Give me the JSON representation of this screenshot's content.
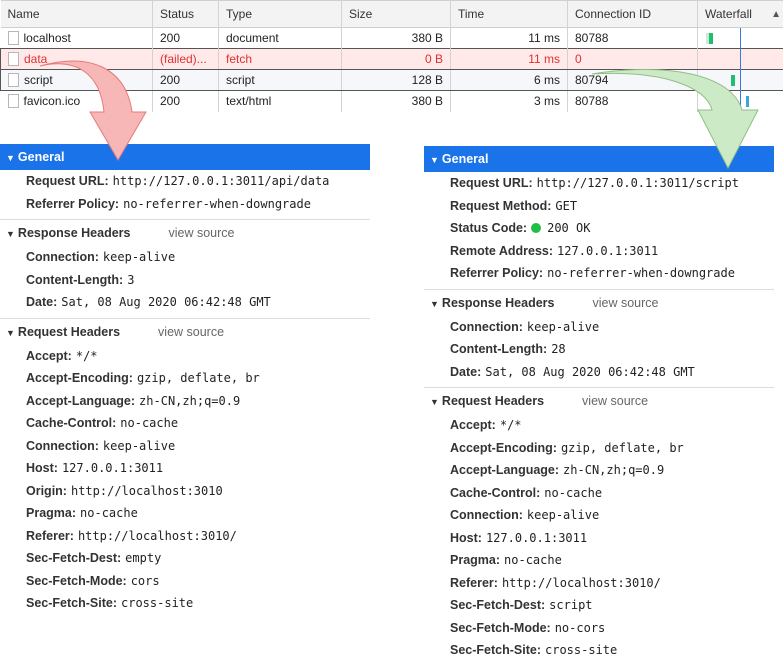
{
  "network": {
    "columns": [
      "Name",
      "Status",
      "Type",
      "Size",
      "Time",
      "Connection ID",
      "Waterfall"
    ],
    "rows": [
      {
        "name": "localhost",
        "status": "200",
        "type": "document",
        "size": "380 B",
        "time": "11 ms",
        "conn": "80788"
      },
      {
        "name": "data",
        "status": "(failed)...",
        "type": "fetch",
        "size": "0 B",
        "time": "11 ms",
        "conn": "0"
      },
      {
        "name": "script",
        "status": "200",
        "type": "script",
        "size": "128 B",
        "time": "6 ms",
        "conn": "80794"
      },
      {
        "name": "favicon.ico",
        "status": "200",
        "type": "text/html",
        "size": "380 B",
        "time": "3 ms",
        "conn": "80788"
      }
    ]
  },
  "left": {
    "general_title": "General",
    "general": [
      {
        "k": "Request URL:",
        "v": "http://127.0.0.1:3011/api/data"
      },
      {
        "k": "Referrer Policy:",
        "v": "no-referrer-when-downgrade"
      }
    ],
    "response_title": "Response Headers",
    "view_source": "view source",
    "response": [
      {
        "k": "Connection:",
        "v": "keep-alive"
      },
      {
        "k": "Content-Length:",
        "v": "3"
      },
      {
        "k": "Date:",
        "v": "Sat, 08 Aug 2020 06:42:48 GMT"
      }
    ],
    "request_title": "Request Headers",
    "request": [
      {
        "k": "Accept:",
        "v": "*/*"
      },
      {
        "k": "Accept-Encoding:",
        "v": "gzip, deflate, br"
      },
      {
        "k": "Accept-Language:",
        "v": "zh-CN,zh;q=0.9"
      },
      {
        "k": "Cache-Control:",
        "v": "no-cache"
      },
      {
        "k": "Connection:",
        "v": "keep-alive"
      },
      {
        "k": "Host:",
        "v": "127.0.0.1:3011"
      },
      {
        "k": "Origin:",
        "v": "http://localhost:3010"
      },
      {
        "k": "Pragma:",
        "v": "no-cache"
      },
      {
        "k": "Referer:",
        "v": "http://localhost:3010/"
      },
      {
        "k": "Sec-Fetch-Dest:",
        "v": "empty"
      },
      {
        "k": "Sec-Fetch-Mode:",
        "v": "cors"
      },
      {
        "k": "Sec-Fetch-Site:",
        "v": "cross-site"
      }
    ]
  },
  "right": {
    "general_title": "General",
    "general": [
      {
        "k": "Request URL:",
        "v": "http://127.0.0.1:3011/script"
      },
      {
        "k": "Request Method:",
        "v": "GET"
      },
      {
        "k": "Status Code:",
        "v": "200 OK"
      },
      {
        "k": "Remote Address:",
        "v": "127.0.0.1:3011"
      },
      {
        "k": "Referrer Policy:",
        "v": "no-referrer-when-downgrade"
      }
    ],
    "response_title": "Response Headers",
    "view_source": "view source",
    "response": [
      {
        "k": "Connection:",
        "v": "keep-alive"
      },
      {
        "k": "Content-Length:",
        "v": "28"
      },
      {
        "k": "Date:",
        "v": "Sat, 08 Aug 2020 06:42:48 GMT"
      }
    ],
    "request_title": "Request Headers",
    "request": [
      {
        "k": "Accept:",
        "v": "*/*"
      },
      {
        "k": "Accept-Encoding:",
        "v": "gzip, deflate, br"
      },
      {
        "k": "Accept-Language:",
        "v": "zh-CN,zh;q=0.9"
      },
      {
        "k": "Cache-Control:",
        "v": "no-cache"
      },
      {
        "k": "Connection:",
        "v": "keep-alive"
      },
      {
        "k": "Host:",
        "v": "127.0.0.1:3011"
      },
      {
        "k": "Pragma:",
        "v": "no-cache"
      },
      {
        "k": "Referer:",
        "v": "http://localhost:3010/"
      },
      {
        "k": "Sec-Fetch-Dest:",
        "v": "script"
      },
      {
        "k": "Sec-Fetch-Mode:",
        "v": "no-cors"
      },
      {
        "k": "Sec-Fetch-Site:",
        "v": "cross-site"
      }
    ]
  },
  "colors": {
    "accent": "#1a73e8",
    "failed": "#e03131",
    "status_ok": "#1fbf45",
    "arrow_red": "#f7b7b7",
    "arrow_green": "#cdeac6"
  }
}
